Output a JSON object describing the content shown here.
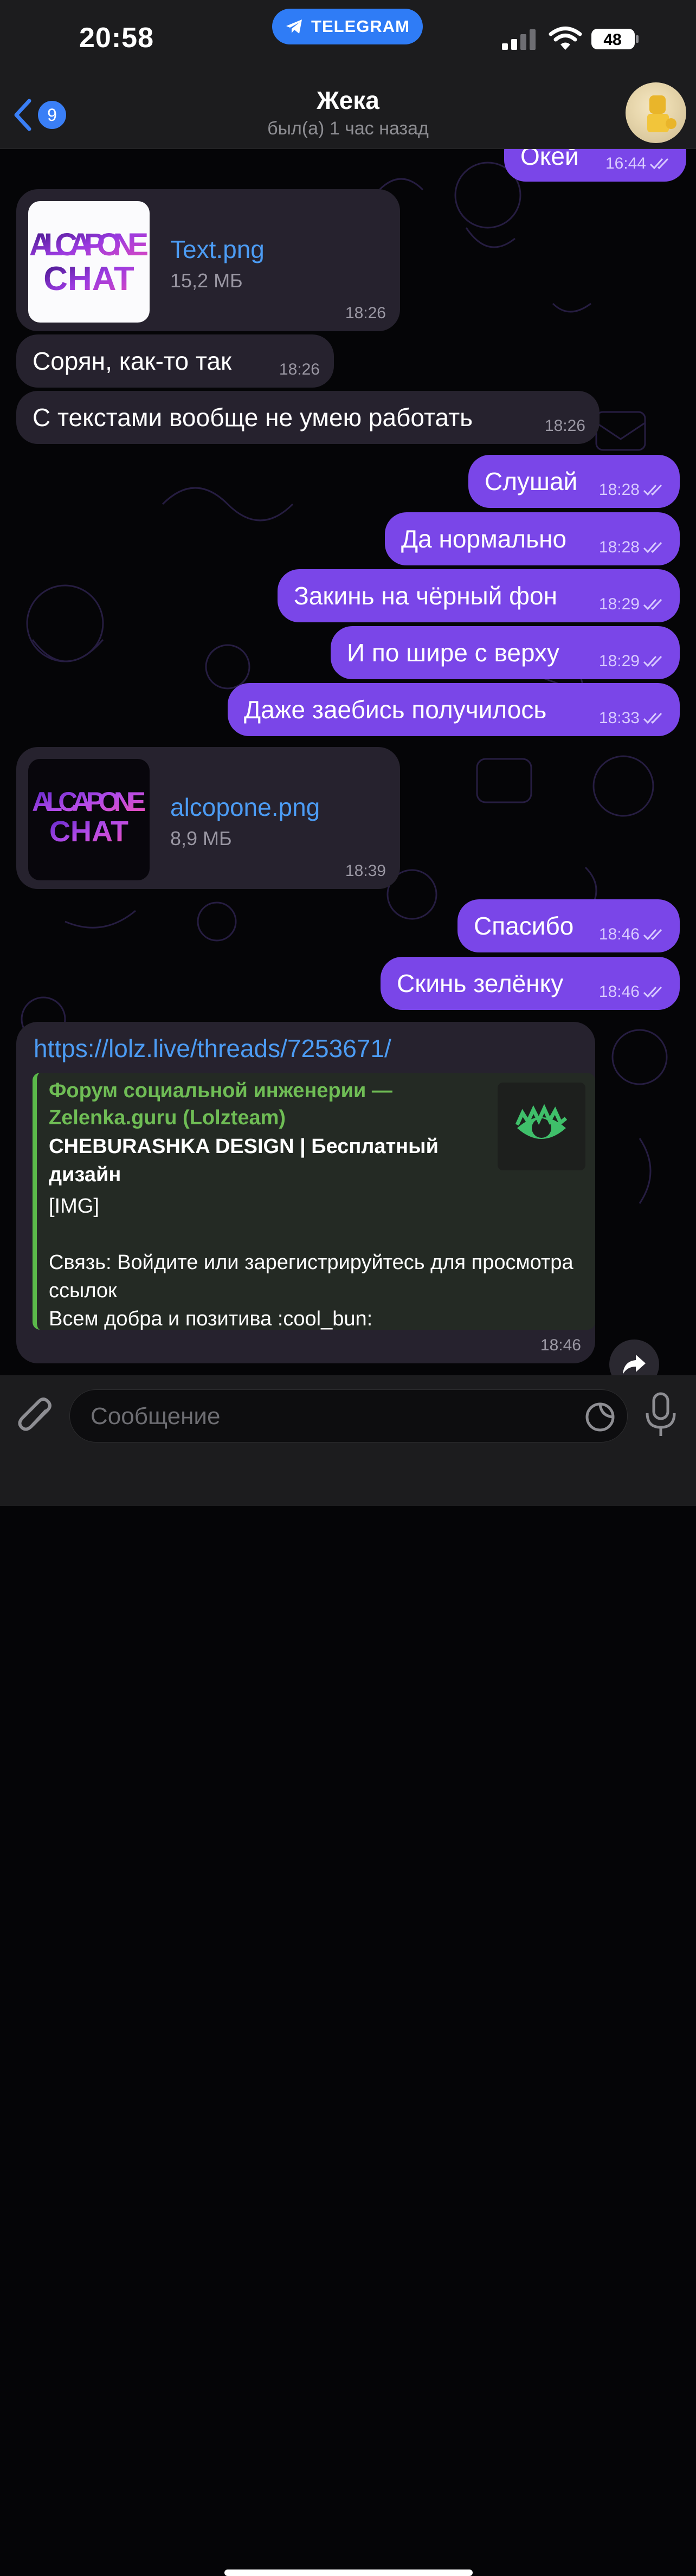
{
  "status_bar": {
    "time": "20:58",
    "app_pill": "TELEGRAM",
    "battery": "48"
  },
  "header": {
    "back_count": "9",
    "title": "Жека",
    "subtitle": "был(а) 1 час назад"
  },
  "messages": [
    {
      "dir": "out",
      "text": "Окей",
      "time": "16:44"
    },
    {
      "dir": "in",
      "type": "file",
      "file_name": "Text.png",
      "file_size": "15,2 МБ",
      "time": "18:26",
      "thumb_text": "AL CAPONE CHAT"
    },
    {
      "dir": "in",
      "text": "Сорян, как-то так",
      "time": "18:26"
    },
    {
      "dir": "in",
      "text": "С текстами вообще не умею работать",
      "time": "18:26"
    },
    {
      "dir": "out",
      "text": "Слушай",
      "time": "18:28"
    },
    {
      "dir": "out",
      "text": "Да нормально",
      "time": "18:28"
    },
    {
      "dir": "out",
      "text": "Закинь на чёрный фон",
      "time": "18:29"
    },
    {
      "dir": "out",
      "text": "И по шире с верху",
      "time": "18:29"
    },
    {
      "dir": "out",
      "text": "Даже заебись получилось",
      "time": "18:33"
    },
    {
      "dir": "in",
      "type": "file",
      "file_name": "alcopone.png",
      "file_size": "8,9 МБ",
      "time": "18:39",
      "thumb_text": "AL CAPONE CHAT"
    },
    {
      "dir": "out",
      "text": "Спасибо",
      "time": "18:46"
    },
    {
      "dir": "out",
      "text": "Скинь зелёнку",
      "time": "18:46"
    },
    {
      "dir": "in",
      "type": "link",
      "url": "https://lolz.live/threads/7253671/",
      "preview_site": "Форум социальной инженерии — Zelenka.guru (Lolzteam)",
      "preview_title": "CHEBURASHKA DESIGN | Бесплатный дизайн",
      "preview_desc": "[IMG]\n\nСвязь: Войдите или зарегистрируйтесь для просмотра ссылок\nВсем добра и позитива :cool_bun:",
      "time": "18:46"
    }
  ],
  "input": {
    "placeholder": "Сообщение"
  },
  "colors": {
    "outgoing": "#7a46e8",
    "incoming": "#26222e",
    "link": "#4c9cf4",
    "preview_accent": "#5bb94a"
  },
  "icons": [
    "back-chevron-icon",
    "telegram-plane-icon",
    "signal-icon",
    "wifi-icon",
    "battery-icon",
    "double-check-icon",
    "share-arrow-icon",
    "paperclip-icon",
    "sticker-icon",
    "microphone-icon"
  ]
}
